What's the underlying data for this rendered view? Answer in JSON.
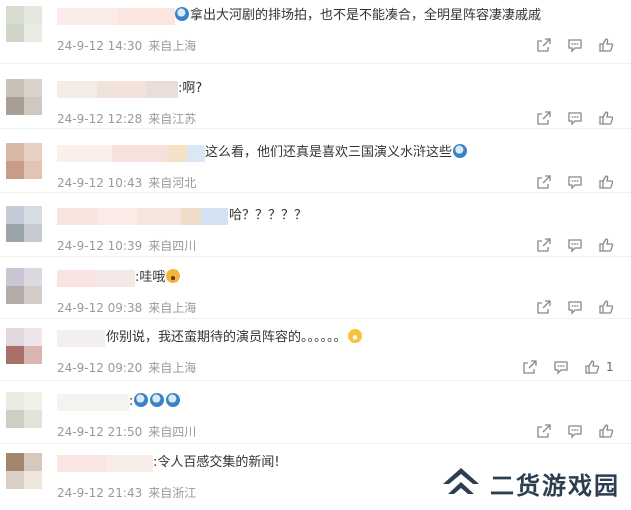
{
  "comments": [
    {
      "text": "拿出大河剧的排场拍，也不是不能凑合，全明星阵容凄凄戚戚",
      "emoji_before": "sweat",
      "emoji_after": "",
      "date": "24-9-12 14:30",
      "location": "来自上海",
      "likes": ""
    },
    {
      "text": ":啊?",
      "emoji_before": "",
      "emoji_after": "",
      "date": "24-9-12 12:28",
      "location": "来自江苏",
      "likes": ""
    },
    {
      "text": "这么看，他们还真是喜欢三国演义水浒这些",
      "emoji_before": "",
      "emoji_after": "sweat",
      "date": "24-9-12 10:43",
      "location": "来自河北",
      "likes": ""
    },
    {
      "text": "哈？？？？？",
      "emoji_before": "",
      "emoji_after": "",
      "date": "24-9-12 10:39",
      "location": "来自四川",
      "likes": ""
    },
    {
      "text": ":哇哦",
      "emoji_before": "",
      "emoji_after": "wow",
      "date": "24-9-12 09:38",
      "location": "来自上海",
      "likes": ""
    },
    {
      "text": "你别说，我还蛮期待的演员阵容的。。。。。。",
      "emoji_before": "",
      "emoji_after": "smirk",
      "date": "24-9-12 09:20",
      "location": "来自上海",
      "likes": "1"
    },
    {
      "text": ":",
      "emoji_before": "",
      "emoji_after": "sweat3",
      "date": "24-9-12 21:50",
      "location": "来自四川",
      "likes": ""
    },
    {
      "text": ":令人百感交集的新闻!",
      "emoji_before": "",
      "emoji_after": "",
      "date": "24-9-12 21:43",
      "location": "来自浙江",
      "likes": ""
    }
  ],
  "watermark": {
    "text": "二货游戏园"
  },
  "colors": {
    "meta": "#999999",
    "icon": "#888888",
    "text": "#333333"
  }
}
